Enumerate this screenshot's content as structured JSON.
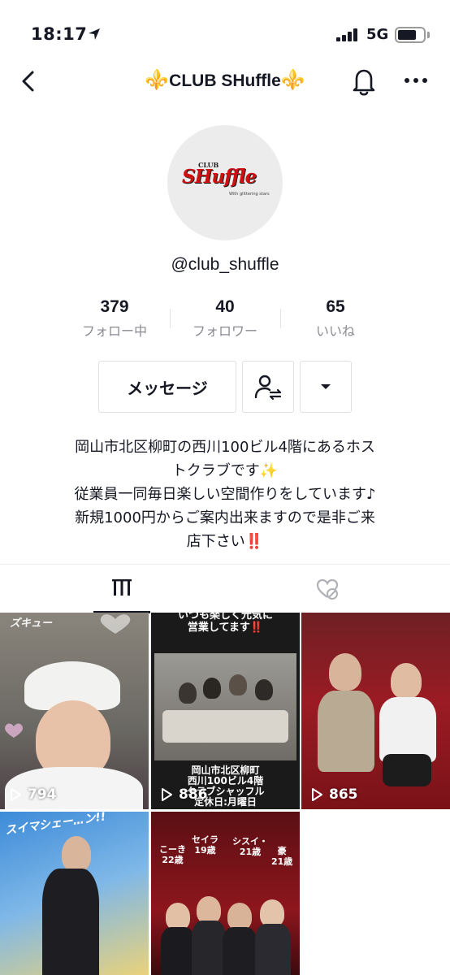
{
  "status_bar": {
    "time": "18:17",
    "network": "5G"
  },
  "nav": {
    "title": "CLUB SHuffle",
    "title_prefix": "⚜️",
    "title_suffix": "⚜️"
  },
  "profile": {
    "avatar_logo": {
      "club": "CLUB",
      "main": "SHuffle",
      "sub": "With glittering stars"
    },
    "username": "@club_shuffle",
    "stats": [
      {
        "value": "379",
        "label": "フォロー中"
      },
      {
        "value": "40",
        "label": "フォロワー"
      },
      {
        "value": "65",
        "label": "いいね"
      }
    ],
    "message_button": "メッセージ",
    "bio": [
      "岡山市北区柳町の西川100ビル4階にあるホス",
      "トクラブです✨",
      "従業員一同毎日楽しい空間作りをしています♪",
      "新規1000円からご案内出来ますので是非ご来",
      "店下さい‼️"
    ]
  },
  "tabs": {
    "videos": "videos-tab",
    "liked": "liked-tab"
  },
  "videos": [
    {
      "views": "794",
      "overlay": "ズキュー",
      "bg": "#7c7a74"
    },
    {
      "views": "886",
      "overlay_top": "いつも楽しく元気に\n営業してます‼️",
      "overlay_bottom": "岡山市北区柳町\n西川100ビル4階\nクラブシャッフル\n定休日:月曜日",
      "bg": "#1d1d1d"
    },
    {
      "views": "865",
      "overlay": "",
      "bg": "#8f1a22"
    },
    {
      "views": "",
      "overlay": "スイマシェー…ン!!",
      "bg": "#4a86c6"
    },
    {
      "views": "",
      "overlay_names": [
        "こーき\n22歳",
        "セイラ\n19歳",
        "シスイ・\n21歳",
        "豪\n21歳"
      ],
      "bg": "#7b1418"
    }
  ],
  "colors": {
    "text": "#161823",
    "secondary": "#8a8b91",
    "accent_red": "#fe2c55",
    "gold": "#c8a23a"
  }
}
